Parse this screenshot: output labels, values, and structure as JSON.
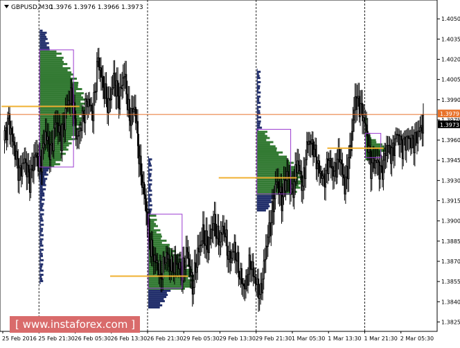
{
  "header": {
    "symbol_label": "GBPUSD,M30",
    "ohlc_label": "1.3976 1.3976 1.3966 1.3973"
  },
  "watermark": {
    "text": "[  www.instaforex.com  ]"
  },
  "colors": {
    "candle": "#000000",
    "hline": "#e8722a",
    "price_badge": "#e8722a",
    "vline": "#222222",
    "profile_navy": "#0b1a5c",
    "profile_green": "#1d6b1d",
    "poc_line": "#f0b030",
    "value_box": "#9a3ad0",
    "watermark_bg": "#d96b6b"
  },
  "chart_data": {
    "type": "candlestick",
    "title": "",
    "ylim": [
      1.3818,
      1.4064
    ],
    "y_ticks": [
      "1.4050",
      "1.4035",
      "1.4020",
      "1.4005",
      "1.3990",
      "1.3975",
      "1.3960",
      "1.3945",
      "1.3930",
      "1.3915",
      "1.3900",
      "1.3885",
      "1.3870",
      "1.3855",
      "1.3840",
      "1.3825"
    ],
    "x_ticks": [
      "25 Feb 2016",
      "25 Feb 21:30",
      "26 Feb 05:30",
      "26 Feb 13:30",
      "26 Feb 21:30",
      "29 Feb 05:30",
      "29 Feb 13:30",
      "29 Feb 21:30",
      "1 Mar 05:30",
      "1 Mar 13:30",
      "1 Mar 21:30",
      "2 Mar 05:30"
    ],
    "price_badges": [
      "1.3979",
      "1.3973"
    ],
    "horizontal_line": 1.3979,
    "current_price": 1.3973,
    "session_separators": [
      "25 Feb 21:30",
      "26 Feb 21:30",
      "29 Feb 21:30",
      "1 Mar 21:30"
    ],
    "close_path": [
      1.396,
      1.3975,
      1.3955,
      1.3935,
      1.3945,
      1.393,
      1.395,
      1.394,
      1.3965,
      1.395,
      1.3975,
      1.396,
      1.3985,
      1.3995,
      1.396,
      1.3975,
      1.399,
      1.398,
      1.402,
      1.4,
      1.3985,
      1.4005,
      1.399,
      1.401,
      1.3975,
      1.3985,
      1.394,
      1.3915,
      1.388,
      1.387,
      1.386,
      1.3875,
      1.3865,
      1.387,
      1.386,
      1.3878,
      1.385,
      1.3875,
      1.389,
      1.388,
      1.39,
      1.3885,
      1.3895,
      1.387,
      1.388,
      1.386,
      1.385,
      1.387,
      1.3855,
      1.3845,
      1.388,
      1.39,
      1.393,
      1.3915,
      1.3935,
      1.392,
      1.3945,
      1.3925,
      1.396,
      1.3955,
      1.394,
      1.393,
      1.3945,
      1.3935,
      1.395,
      1.3925,
      1.395,
      1.399,
      1.3985,
      1.397,
      1.394,
      1.3945,
      1.3935,
      1.3955,
      1.395,
      1.3965,
      1.3955,
      1.3962,
      1.3958,
      1.3965,
      1.3973
    ],
    "profiles": [
      {
        "label": "25 Feb 21:30",
        "color": "navy",
        "low": 1.3853,
        "high": 1.4042,
        "poc": 1.3985,
        "va_low": 1.394,
        "va_high": 1.4027
      },
      {
        "label": "26 Feb 21:30",
        "color": "navy",
        "low": 1.3835,
        "high": 1.3948,
        "poc": 1.3859,
        "va_low": 1.385,
        "va_high": 1.3905
      },
      {
        "label": "29 Feb 21:30",
        "color": "navy",
        "low": 1.3907,
        "high": 1.4013,
        "poc": 1.3932,
        "va_low": 1.392,
        "va_high": 1.3968
      },
      {
        "label": "1 Mar 21:30",
        "color": "green",
        "low": 1.3945,
        "high": 1.3978,
        "poc": 1.3954,
        "va_low": 1.3947,
        "va_high": 1.3965
      }
    ]
  }
}
